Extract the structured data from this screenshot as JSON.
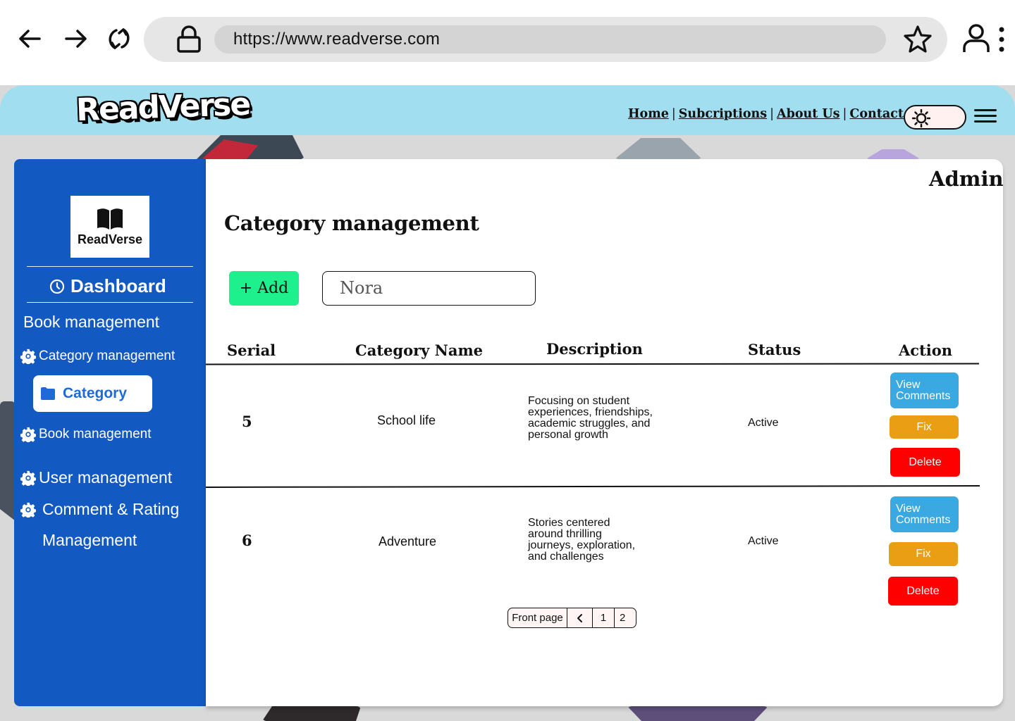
{
  "browser": {
    "url": "https://www.readverse.com"
  },
  "site": {
    "logo_text": "ReadVerse",
    "nav": [
      "Home",
      "Subcriptions",
      "About Us",
      "Contact Us"
    ]
  },
  "sidebar": {
    "logo_text": "ReadVerse",
    "dashboard": "Dashboard",
    "section_title": "Book management",
    "items": {
      "category_management": "Category management",
      "category": "Category",
      "book_management": "Book management",
      "user_management": "User management",
      "comment_rating_line1": "Comment & Rating",
      "comment_rating_line2": "Management"
    }
  },
  "main": {
    "role": "Admin",
    "title": "Category management",
    "add_label": "+ Add",
    "search_value": "Nora",
    "columns": [
      "Serial",
      "Category Name",
      "Description",
      "Status",
      "Action"
    ],
    "rows": [
      {
        "serial": "5",
        "name": "School life",
        "description": [
          "Focusing on student",
          "experiences, friendships,",
          "academic struggles, and",
          "personal growth"
        ],
        "status": "Active"
      },
      {
        "serial": "6",
        "name": "Adventure",
        "description": [
          "Stories centered",
          "around thrilling",
          "journeys, exploration,",
          "and challenges"
        ],
        "status": "Active"
      }
    ],
    "actions": {
      "view_line1": "View",
      "view_line2": "Comments",
      "fix": "Fix",
      "delete": "Delete"
    },
    "pagination": {
      "front_page": "Front page",
      "pages": [
        "1",
        "2"
      ]
    }
  },
  "colors": {
    "header_bg": "#a1dff0",
    "sidebar_bg": "#1359c2",
    "add_button": "#1ef08d",
    "view_button": "#3aa9e2",
    "fix_button": "#ea9e13",
    "delete_button": "#ff0000"
  },
  "icons": [
    "back-arrow-icon",
    "forward-arrow-icon",
    "reload-icon",
    "lock-icon",
    "star-icon",
    "user-icon",
    "kebab-menu-icon",
    "sun-icon",
    "hamburger-icon",
    "book-icon",
    "clock-icon",
    "gear-icon",
    "folder-icon",
    "chevron-left-icon"
  ]
}
